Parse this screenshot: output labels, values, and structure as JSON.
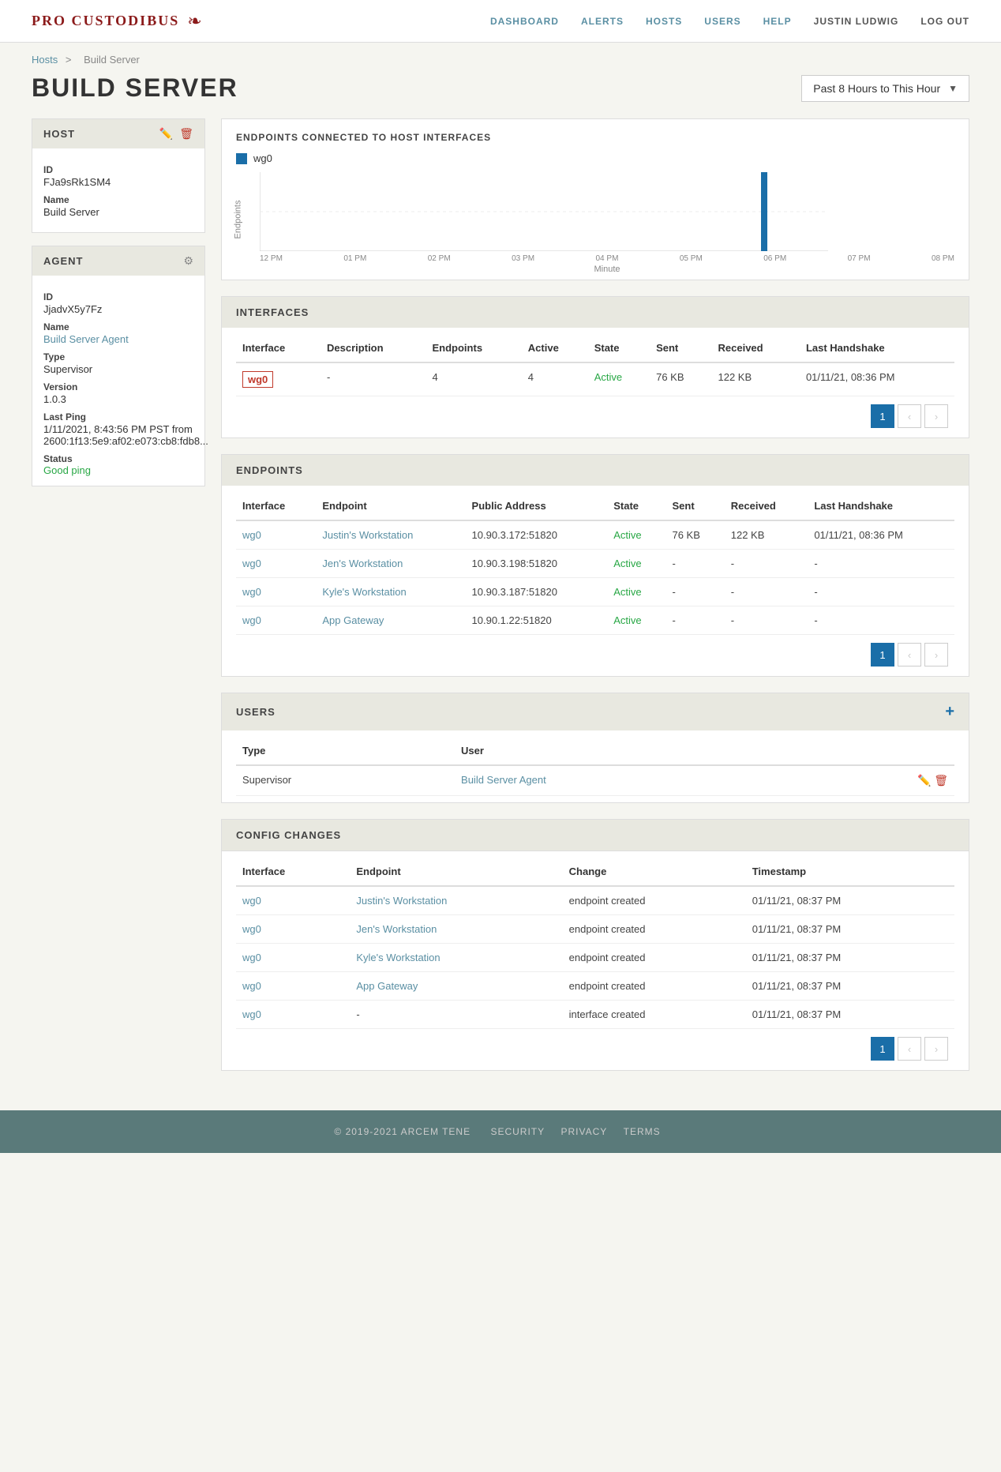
{
  "brand": {
    "text": "PRO CUSTODIBUS",
    "icon": "❧"
  },
  "nav": {
    "links": [
      {
        "label": "DASHBOARD",
        "href": "#"
      },
      {
        "label": "ALERTS",
        "href": "#"
      },
      {
        "label": "HOSTS",
        "href": "#"
      },
      {
        "label": "USERS",
        "href": "#"
      },
      {
        "label": "HELP",
        "href": "#"
      },
      {
        "label": "JUSTIN LUDWIG",
        "href": "#",
        "class": "user"
      },
      {
        "label": "LOG OUT",
        "href": "#",
        "class": "user"
      }
    ]
  },
  "breadcrumb": {
    "parent": "Hosts",
    "current": "Build Server"
  },
  "page": {
    "title": "BUILD SERVER",
    "time_selector": "Past 8 Hours to This Hour"
  },
  "host_panel": {
    "title": "HOST",
    "fields": [
      {
        "label": "ID",
        "value": "FJa9sRk1SM4"
      },
      {
        "label": "Name",
        "value": "Build Server"
      }
    ]
  },
  "agent_panel": {
    "title": "AGENT",
    "fields": [
      {
        "label": "ID",
        "value": "JjadvX5y7Fz"
      },
      {
        "label": "Name",
        "value": "Build Server Agent",
        "link": true
      },
      {
        "label": "Type",
        "value": "Supervisor"
      },
      {
        "label": "Version",
        "value": "1.0.3"
      },
      {
        "label": "Last Ping",
        "value": "1/11/2021, 8:43:56 PM PST from 2600:1f13:5e9:af02:e073:cb8:fdb8..."
      },
      {
        "label": "Status",
        "value": "Good ping",
        "status": "good"
      }
    ]
  },
  "chart": {
    "title": "ENDPOINTS CONNECTED TO HOST INTERFACES",
    "legend_label": "wg0",
    "y_label": "Endpoints",
    "x_label": "Minute",
    "x_ticks": [
      "12 PM",
      "01 PM",
      "02 PM",
      "03 PM",
      "04 PM",
      "05 PM",
      "06 PM",
      "07 PM",
      "08 PM"
    ],
    "y_max": 1,
    "y_mid": 0.5,
    "spike_position": 0.875,
    "spike_height": 1
  },
  "interfaces": {
    "title": "INTERFACES",
    "columns": [
      "Interface",
      "Description",
      "Endpoints",
      "Active",
      "State",
      "Sent",
      "Received",
      "Last Handshake"
    ],
    "rows": [
      {
        "interface": "wg0",
        "interface_link": true,
        "interface_bordered": true,
        "description": "-",
        "endpoints": "4",
        "active": "4",
        "state": "Active",
        "sent": "76 KB",
        "received": "122 KB",
        "last_handshake": "01/11/21, 08:36 PM"
      }
    ],
    "pagination": {
      "current": 1,
      "total": 1
    }
  },
  "endpoints": {
    "title": "ENDPOINTS",
    "columns": [
      "Interface",
      "Endpoint",
      "Public Address",
      "State",
      "Sent",
      "Received",
      "Last Handshake"
    ],
    "rows": [
      {
        "interface": "wg0",
        "endpoint": "Justin's Workstation",
        "public_address": "10.90.3.172:51820",
        "state": "Active",
        "sent": "76 KB",
        "received": "122 KB",
        "last_handshake": "01/11/21, 08:36 PM"
      },
      {
        "interface": "wg0",
        "endpoint": "Jen's Workstation",
        "public_address": "10.90.3.198:51820",
        "state": "Active",
        "sent": "-",
        "received": "-",
        "last_handshake": "-"
      },
      {
        "interface": "wg0",
        "endpoint": "Kyle's Workstation",
        "public_address": "10.90.3.187:51820",
        "state": "Active",
        "sent": "-",
        "received": "-",
        "last_handshake": "-"
      },
      {
        "interface": "wg0",
        "endpoint": "App Gateway",
        "public_address": "10.90.1.22:51820",
        "state": "Active",
        "sent": "-",
        "received": "-",
        "last_handshake": "-"
      }
    ],
    "pagination": {
      "current": 1,
      "total": 1
    }
  },
  "users": {
    "title": "USERS",
    "columns": [
      "Type",
      "User"
    ],
    "rows": [
      {
        "type": "Supervisor",
        "user": "Build Server Agent",
        "user_link": true
      }
    ]
  },
  "config_changes": {
    "title": "CONFIG CHANGES",
    "columns": [
      "Interface",
      "Endpoint",
      "Change",
      "Timestamp"
    ],
    "rows": [
      {
        "interface": "wg0",
        "endpoint": "Justin's Workstation",
        "change": "endpoint created",
        "timestamp": "01/11/21, 08:37 PM"
      },
      {
        "interface": "wg0",
        "endpoint": "Jen's Workstation",
        "change": "endpoint created",
        "timestamp": "01/11/21, 08:37 PM"
      },
      {
        "interface": "wg0",
        "endpoint": "Kyle's Workstation",
        "change": "endpoint created",
        "timestamp": "01/11/21, 08:37 PM"
      },
      {
        "interface": "wg0",
        "endpoint": "App Gateway",
        "change": "endpoint created",
        "timestamp": "01/11/21, 08:37 PM"
      },
      {
        "interface": "wg0",
        "endpoint": "-",
        "change": "interface created",
        "timestamp": "01/11/21, 08:37 PM"
      }
    ],
    "pagination": {
      "current": 1,
      "total": 1
    }
  },
  "footer": {
    "copyright": "© 2019-2021 ARCEM TENE",
    "links": [
      "SECURITY",
      "PRIVACY",
      "TERMS"
    ]
  }
}
